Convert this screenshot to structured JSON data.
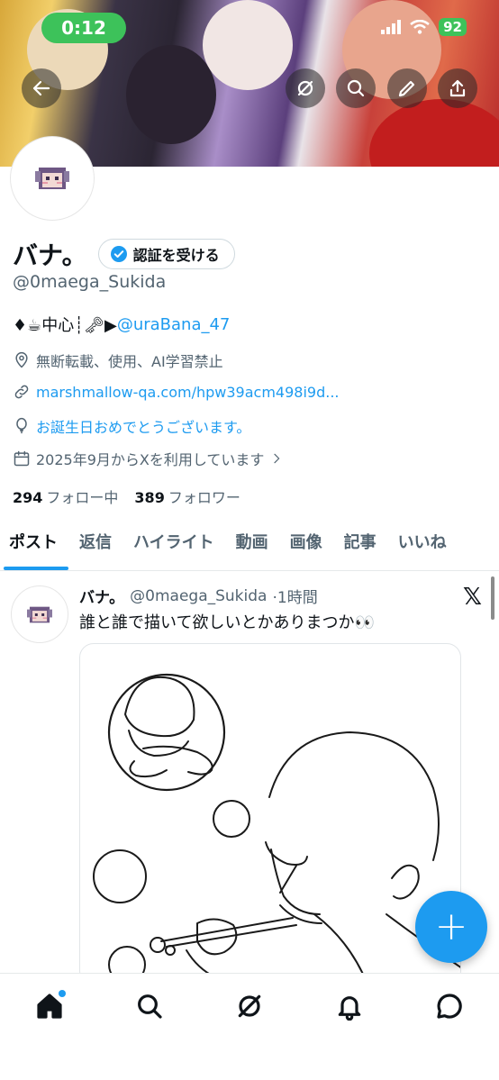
{
  "status_bar": {
    "time": "0:12",
    "battery": "92"
  },
  "profile": {
    "display_name": "バナ。",
    "verify_label": "認証を受ける",
    "handle": "@0maega_Sukida",
    "bio_prefix": "♦☕中心┊🗝▶",
    "bio_link": "@uraBana_47",
    "notice": "無断転載、使用、AI学習禁止",
    "website": "marshmallow-qa.com/hpw39acm498i9d...",
    "birthday": "お誕生日おめでとうございます。",
    "joined": "2025年9月からXを利用しています",
    "following_count": "294",
    "following_label": "フォロー中",
    "followers_count": "389",
    "followers_label": "フォロワー"
  },
  "tabs": [
    {
      "label": "ポスト",
      "active": true
    },
    {
      "label": "返信"
    },
    {
      "label": "ハイライト"
    },
    {
      "label": "動画"
    },
    {
      "label": "画像"
    },
    {
      "label": "記事"
    },
    {
      "label": "いいね"
    }
  ],
  "post": {
    "name": "バナ。",
    "handle": "@0maega_Sukida",
    "time": "·1時間",
    "text": "誰と誰で描いて欲しいとかありまつか👀"
  },
  "fab": {
    "label": "+"
  },
  "icons": {
    "back": "back-arrow-icon",
    "grok": "grok-icon",
    "search": "search-icon",
    "edit": "pencil-icon",
    "share": "share-icon",
    "home": "home-icon",
    "notifications": "bell-icon",
    "messages": "message-icon"
  },
  "colors": {
    "accent": "#1d9bf0",
    "status_green": "#3dc25a",
    "text": "#0f1419",
    "muted": "#536471"
  }
}
